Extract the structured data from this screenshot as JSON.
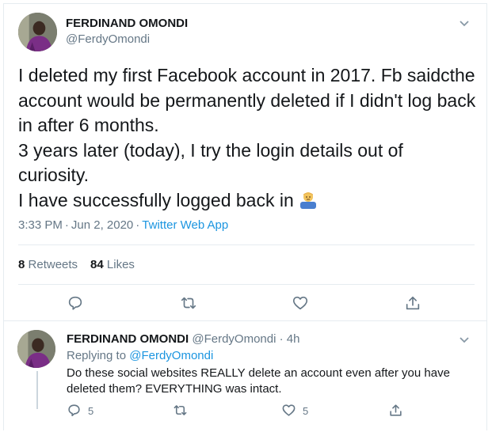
{
  "tweet": {
    "author_name": "FERDINAND OMONDI",
    "author_handle": "@FerdyOmondi",
    "text": "I deleted my first Facebook account in 2017.  Fb saidcthe account would be permanently deleted if I didn't log back in after 6 months.\n3 years later (today), I try the login details out of curiosity.\nI have successfully logged back in",
    "emoji_icon": "man-shrugging-emoji",
    "time": "3:33 PM",
    "date": "Jun 2, 2020",
    "source": "Twitter Web App",
    "retweets_count": "8",
    "retweets_label": "Retweets",
    "likes_count": "84",
    "likes_label": "Likes"
  },
  "reply": {
    "author_name": "FERDINAND OMONDI",
    "author_handle": "@FerdyOmondi",
    "age": "4h",
    "replying_to_label": "Replying to",
    "replying_to_handle": "@FerdyOmondi",
    "text": "Do these social websites REALLY delete an account even after you have deleted them? EVERYTHING was intact.",
    "reply_count": "5",
    "like_count": "5"
  },
  "colors": {
    "accent": "#1b95e0",
    "secondary_text": "#657786",
    "border": "#e6ecf0"
  },
  "icons": [
    "reply-icon",
    "retweet-icon",
    "like-icon",
    "share-icon",
    "chevron-down-icon"
  ]
}
